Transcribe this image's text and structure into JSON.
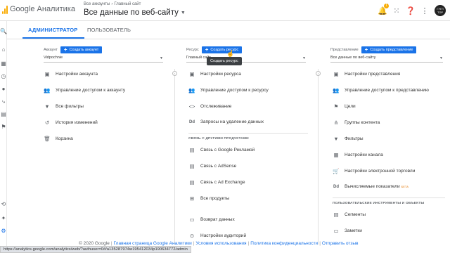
{
  "header": {
    "brand": "Google Аналитика",
    "breadcrumb": [
      "Все аккаунты",
      "Главный сайт"
    ],
    "breadcrumb_sep": "›",
    "view_title": "Все данные по веб-сайту",
    "notification_count": "1",
    "avatar_text": "ГУГЛ ТОР"
  },
  "tabs": [
    {
      "label": "АДМИНИСТРАТОР",
      "active": true
    },
    {
      "label": "ПОЛЬЗОВАТЕЛЬ",
      "active": false
    }
  ],
  "account": {
    "label": "Аккаунт",
    "create_button": "Создать аккаунт",
    "selected": "Vidpochnie",
    "items": [
      {
        "icon": "settings-icon",
        "label": "Настройки аккаунта"
      },
      {
        "icon": "people-icon",
        "label": "Управление доступом к аккаунту"
      },
      {
        "icon": "filter-icon",
        "label": "Все фильтры"
      },
      {
        "icon": "history-icon",
        "label": "История изменений"
      },
      {
        "icon": "trash-icon",
        "label": "Корзина"
      }
    ]
  },
  "property": {
    "label": "Ресурс",
    "create_button": "Создать ресурс",
    "selected": "Главный сайт",
    "tooltip": "Создать ресурс",
    "items": [
      {
        "icon": "settings-icon",
        "label": "Настройки ресурса"
      },
      {
        "icon": "people-icon",
        "label": "Управление доступом к ресурсу"
      },
      {
        "icon": "code-icon",
        "label": "Отслеживание"
      },
      {
        "icon": "dd-icon",
        "label": "Запросы на удаление данных"
      }
    ],
    "section_title": "СВЯЗЬ С ДРУГИМИ ПРОДУКТАМИ",
    "product_items": [
      {
        "icon": "ads-icon",
        "label": "Связь с Google Рекламой"
      },
      {
        "icon": "adsense-icon",
        "label": "Связь с AdSense"
      },
      {
        "icon": "adexchange-icon",
        "label": "Связь с Ad Exchange"
      },
      {
        "icon": "products-icon",
        "label": "Все продукты"
      },
      {
        "icon": "postback-icon",
        "label": "Возврат данных"
      },
      {
        "icon": "audience-icon",
        "label": "Настройки аудиторий"
      }
    ]
  },
  "view": {
    "label": "Представление",
    "create_button": "Создать представление",
    "selected": "Все данные по веб-сайту",
    "items": [
      {
        "icon": "settings-icon",
        "label": "Настройки представления"
      },
      {
        "icon": "people-icon",
        "label": "Управление доступом к представлению"
      },
      {
        "icon": "flag-icon",
        "label": "Цели"
      },
      {
        "icon": "group-icon",
        "label": "Группы контента"
      },
      {
        "icon": "filter-icon",
        "label": "Фильтры"
      },
      {
        "icon": "channel-icon",
        "label": "Настройки канала"
      },
      {
        "icon": "cart-icon",
        "label": "Настройки электронной торговли"
      },
      {
        "icon": "dd-icon",
        "label": "Вычисляемые показатели",
        "badge": "БЕТА"
      }
    ],
    "section_title": "ПОЛЬЗОВАТЕЛЬСКИЕ ИНСТРУМЕНТЫ И ОБЪЕКТЫ",
    "tool_items": [
      {
        "icon": "segments-icon",
        "label": "Сегменты"
      },
      {
        "icon": "notes-icon",
        "label": "Заметки"
      }
    ]
  },
  "footer": {
    "copyright": "© 2020 Google",
    "links": [
      "Главная страница Google Аналитики",
      "Условия использования",
      "Политика конфиденциальности",
      "Отправить отзыв"
    ]
  },
  "status_url": "https://analytics.google.com/analytics/web/?authuser=0#/a135287974w195412034p190634772/admin"
}
